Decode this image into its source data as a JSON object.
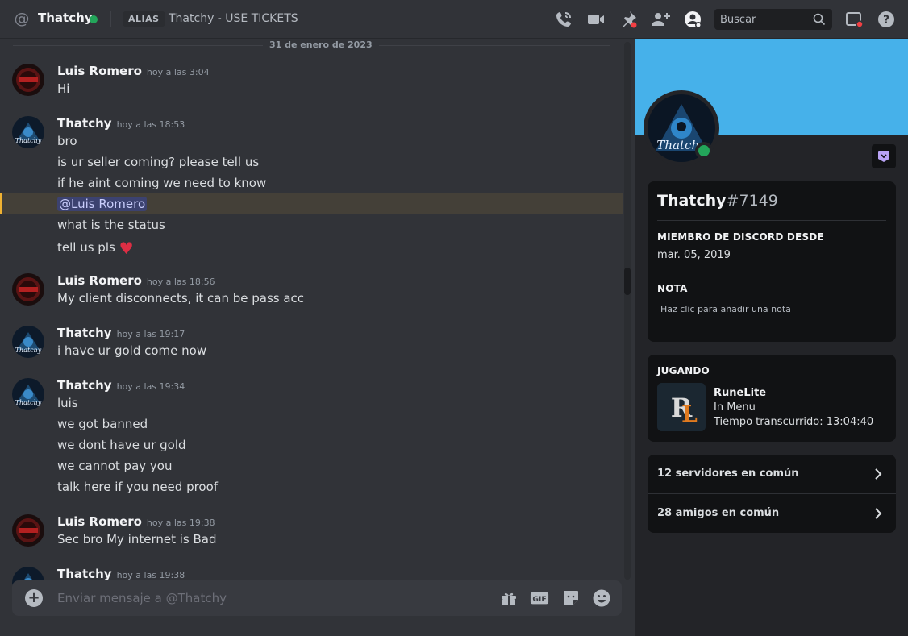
{
  "header": {
    "name": "Thatchy",
    "alias_badge": "ALIAS",
    "alias_text": "Thatchy - USE TICKETS",
    "search_placeholder": "Buscar",
    "icons": [
      "at-icon",
      "call-icon",
      "video-icon",
      "pin-icon",
      "add-friend-icon",
      "profile-icon",
      "search-icon",
      "inbox-icon",
      "help-icon"
    ]
  },
  "chat": {
    "date_divider": "31 de enero de 2023",
    "groups": [
      {
        "author": "Luis Romero",
        "timestamp": "hoy a las 3:04",
        "lines": [
          "Hi"
        ]
      },
      {
        "author": "Thatchy",
        "timestamp": "hoy a las 18:53",
        "lines": [
          "bro",
          "is ur seller coming? please tell us",
          "if he aint coming we need to know",
          "@Luis Romero",
          "what is the status",
          "tell us pls"
        ]
      },
      {
        "author": "Luis Romero",
        "timestamp": "hoy a las 18:56",
        "lines": [
          "My client disconnects, it can be pass acc"
        ]
      },
      {
        "author": "Thatchy",
        "timestamp": "hoy a las 19:17",
        "lines": [
          "i have ur gold come now"
        ]
      },
      {
        "author": "Thatchy",
        "timestamp": "hoy a las 19:34",
        "lines": [
          "luis",
          "we got banned",
          "we dont have ur gold",
          "we cannot pay you",
          "talk here if you need proof"
        ]
      },
      {
        "author": "Luis Romero",
        "timestamp": "hoy a las 19:38",
        "lines": [
          "Sec bro My internet is Bad"
        ]
      },
      {
        "author": "Thatchy",
        "timestamp": "hoy a las 19:38",
        "lines": []
      }
    ],
    "composer_placeholder": "Enviar mensaje a @Thatchy",
    "gif_label": "GIF"
  },
  "profile": {
    "username": "Thatchy",
    "discriminator": "#7149",
    "member_since_title": "MIEMBRO DE DISCORD DESDE",
    "member_since": "mar. 05, 2019",
    "note_title": "NOTA",
    "note_placeholder": "Haz clic para añadir una nota",
    "playing_title": "JUGANDO",
    "game": {
      "name": "RuneLite",
      "state": "In Menu",
      "elapsed": "Tiempo transcurrido: 13:04:40"
    },
    "mutual_servers": "12 servidores en común",
    "mutual_friends": "28 amigos en común"
  },
  "colors": {
    "accent": "#46b1ea",
    "online": "#23a55a",
    "mention_bg": "#3c4270",
    "highlight_border": "#f0b232"
  }
}
